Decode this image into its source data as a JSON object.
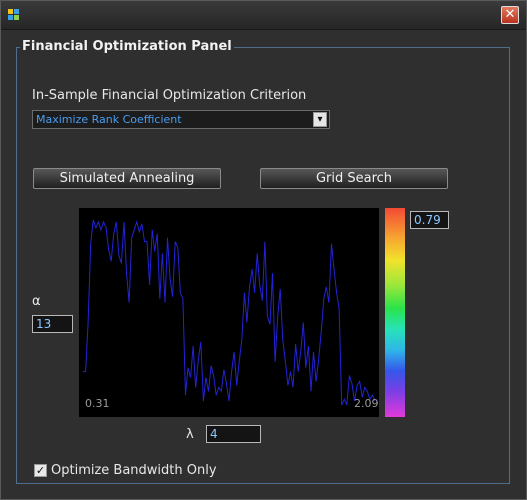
{
  "window": {
    "close_glyph": "✕"
  },
  "panel": {
    "title": "Financial Optimization Panel"
  },
  "criterion": {
    "label": "In-Sample Financial Optimization Criterion",
    "selected": "Maximize Rank Coefficient",
    "arrow_glyph": "▾"
  },
  "buttons": {
    "annealing": "Simulated Annealing",
    "grid": "Grid Search"
  },
  "alpha": {
    "label": "α",
    "value": "13"
  },
  "lambda": {
    "label": "λ",
    "value": "4"
  },
  "plot": {
    "x_min_label": "0.31",
    "x_max_label": "2.09",
    "line_color": "#2323d6"
  },
  "colorbar": {
    "top_value": "0.79"
  },
  "option": {
    "checked_glyph": "✓",
    "label": "Optimize Bandwidth Only"
  },
  "chart_data": {
    "type": "line",
    "title": "",
    "xlabel": "",
    "ylabel": "",
    "x_range": [
      0.31,
      2.09
    ],
    "y_range": [
      0,
      1
    ],
    "series": [
      {
        "values": [
          0.2,
          0.2,
          0.45,
          0.85,
          0.97,
          0.93,
          0.96,
          0.92,
          0.96,
          0.93,
          0.82,
          0.76,
          0.9,
          0.96,
          0.79,
          0.75,
          0.96,
          0.7,
          0.55,
          0.88,
          0.92,
          0.96,
          0.91,
          0.95,
          0.86,
          0.86,
          0.64,
          0.92,
          0.81,
          0.9,
          0.57,
          0.8,
          0.55,
          0.88,
          0.67,
          0.58,
          0.86,
          0.83,
          0.6,
          0.57,
          0.08,
          0.22,
          0.17,
          0.33,
          0.12,
          0.26,
          0.35,
          0.05,
          0.17,
          0.1,
          0.23,
          0.18,
          0.08,
          0.12,
          0.1,
          0.21,
          0.14,
          0.05,
          0.2,
          0.3,
          0.13,
          0.25,
          0.36,
          0.6,
          0.45,
          0.63,
          0.72,
          0.6,
          0.8,
          0.64,
          0.56,
          0.86,
          0.48,
          0.44,
          0.7,
          0.25,
          0.48,
          0.62,
          0.36,
          0.25,
          0.13,
          0.2,
          0.12,
          0.34,
          0.2,
          0.3,
          0.45,
          0.22,
          0.33,
          0.1,
          0.3,
          0.15,
          0.26,
          0.4,
          0.57,
          0.63,
          0.55,
          0.85,
          0.72,
          0.6,
          0.52,
          0.03,
          0.06,
          0.03,
          0.18,
          0.14,
          0.05,
          0.13,
          0.15,
          0.07,
          0.12,
          0.1,
          0.06,
          0.08,
          0.05
        ]
      }
    ]
  }
}
